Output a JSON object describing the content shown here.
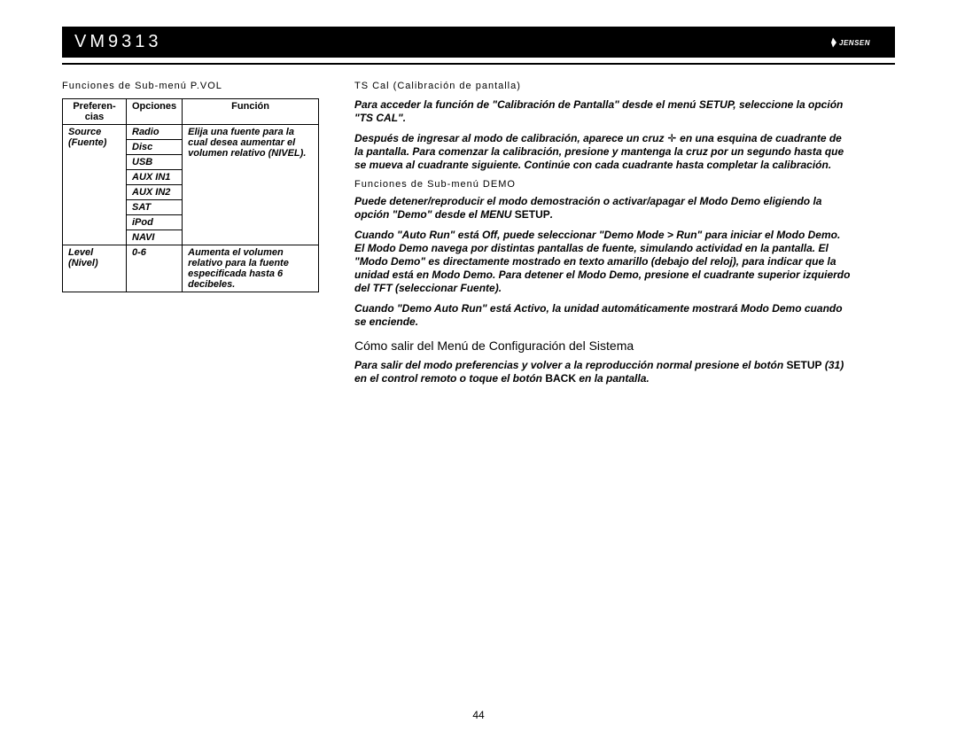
{
  "header": {
    "title": "VM9313",
    "brand": "JENSEN"
  },
  "page_number": "44",
  "left": {
    "heading": "Funciones de Sub-menú P.VOL",
    "table": {
      "headers": [
        "Preferen-cias",
        "Opciones",
        "Función"
      ],
      "row1": {
        "pref": "Source (Fuente)",
        "func": "Elija una fuente para la cual desea aumentar el volumen relativo (NIVEL).",
        "options": [
          "Radio",
          "Disc",
          "USB",
          "AUX IN1",
          "AUX IN2",
          "SAT",
          "iPod",
          "NAVI"
        ]
      },
      "row2": {
        "pref": "Level (Nivel)",
        "opt": "0-6",
        "func": "Aumenta el volumen relativo para la fuente especificada hasta 6 decibeles."
      }
    }
  },
  "right": {
    "ts_heading": "TS Cal (Calibración de pantalla)",
    "ts_p1": "Para acceder la función de \"Calibración de Pantalla\" desde el menú SETUP, seleccione la opción \"TS CAL\".",
    "ts_p2a": "Después de ingresar al modo de calibración, aparece un cruz",
    "ts_p2b": " en una esquina de cuadrante de la pantalla. Para comenzar la calibración, presione y mantenga la cruz por un segundo hasta que se mueva al cuadrante siguiente. Continúe con cada cuadrante hasta completar la calibración.",
    "demo_heading": "Funciones de Sub-menú DEMO",
    "demo_p1a": "Puede detener/reproducir el modo demostración o activar/apagar el Modo Demo eligiendo la opción \"Demo\" desde el MENU ",
    "demo_p1b": "SETUP",
    "demo_p1c": ".",
    "demo_p2": "Cuando \"Auto Run\" está Off, puede seleccionar \"Demo Mode > Run\" para iniciar el Modo Demo. El Modo Demo navega por distintas pantallas de fuente, simulando actividad en la pantalla. El \"Modo Demo\" es directamente mostrado en texto amarillo (debajo del reloj), para indicar que la unidad está en Modo Demo. Para detener el Modo Demo, presione el cuadrante superior izquierdo del TFT (seleccionar Fuente).",
    "demo_p3": "Cuando \"Demo Auto Run\" está Activo, la unidad automáticamente mostrará Modo Demo cuando se enciende.",
    "exit_title": "Cómo salir del Menú de Configuración del Sistema",
    "exit_p_a": "Para salir del modo preferencias y volver a la reproducción normal presione el botón ",
    "exit_p_b": "SETUP",
    "exit_p_c": " (31) en el control remoto o toque el botón ",
    "exit_p_d": "BACK",
    "exit_p_e": " en la pantalla."
  }
}
